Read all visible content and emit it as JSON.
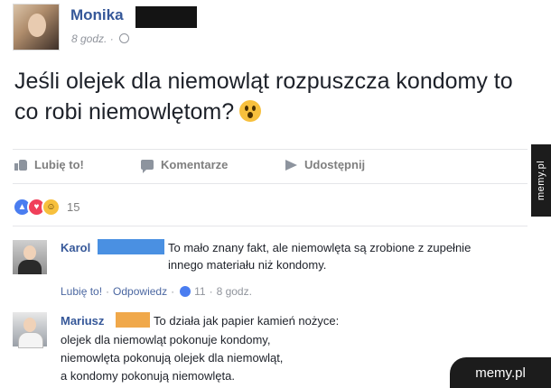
{
  "post": {
    "author": "Monika",
    "time": "8 godz.",
    "separator": "·",
    "text": "Jeśli olejek dla niemowląt rozpuszcza kondomy to co robi niemowlętom?"
  },
  "actions": {
    "like": "Lubię to!",
    "comment": "Komentarze",
    "share": "Udostępnij"
  },
  "reactions": {
    "count": "15"
  },
  "comments": [
    {
      "name": "Karol",
      "text": "To mało znany fakt, ale niemowlęta są zrobione z zupełnie innego materiału niż kondomy.",
      "like": "Lubię to!",
      "reply": "Odpowiedz",
      "likes": "11",
      "time": "8 godz."
    },
    {
      "name": "Mariusz",
      "line1": "To działa jak papier kamień nożyce:",
      "line2": "olejek dla niemowląt pokonuje kondomy,",
      "line3": "niemowlęta pokonują olejek dla niemowląt,",
      "line4": "a kondomy pokonują niemowlęta."
    }
  ],
  "watermark": {
    "side": "memy.pl",
    "corner": "memy.pl"
  },
  "icons": {
    "like_action": "thumbs-up-icon",
    "comment_action": "comment-icon",
    "share_action": "share-arrow-icon",
    "privacy": "globe-icon",
    "reaction_like": "like-reaction-icon",
    "reaction_love": "love-reaction-icon",
    "reaction_haha": "haha-reaction-icon",
    "post_emoji": "wow-emoji-icon"
  },
  "colors": {
    "name_link": "#365899",
    "meta_text": "#90949c",
    "redact_dark": "#141414",
    "redact_blue": "#4a90e2",
    "redact_orange": "#f0a84a",
    "watermark_bg": "#1c1c1c"
  }
}
